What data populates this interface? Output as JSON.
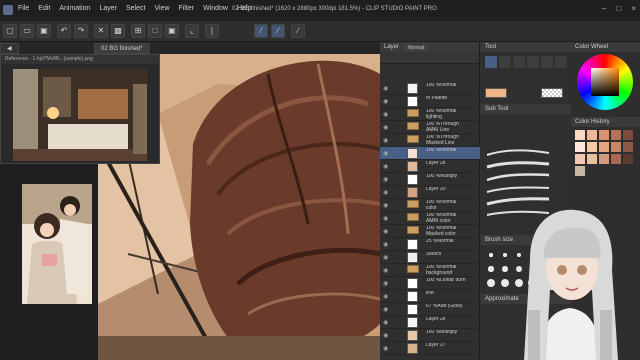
{
  "window": {
    "menu": [
      "File",
      "Edit",
      "Animation",
      "Layer",
      "Select",
      "View",
      "Filter",
      "Window",
      "Help"
    ],
    "title": "02 BG finished* (1620 x 2880px 300dpi 181.5%)  - CLIP STUDIO PAINT PRO"
  },
  "tabs": {
    "canvas_tab": "02 BG finished*"
  },
  "navigator": {
    "header": "Reference - 1-hjd7Mv8N...(sample).png"
  },
  "panels": {
    "layer_header": "Layer",
    "blend_mode": "Normal",
    "tool_header": "Tool",
    "sub_tool_header": "Sub Tool",
    "color_wheel_header": "Color Wheel",
    "color_history_header": "Color History",
    "brush_size_header": "Brush size",
    "approximate_header": "Approximate"
  },
  "layers": [
    {
      "name": "100 %Normal",
      "type": "layer",
      "thumb": "#f2f2f2"
    },
    {
      "name": "In Palette",
      "type": "layer",
      "thumb": "#ffffff"
    },
    {
      "name": "100 %Normal\nlighting",
      "type": "folder"
    },
    {
      "name": "100 %Through\nAMAI Line",
      "type": "folder"
    },
    {
      "name": "100 %Through\nMasked Line",
      "type": "folder"
    },
    {
      "name": "100 %Normal",
      "type": "layer",
      "selected": true,
      "thumb": "#f3e0d6"
    },
    {
      "name": "Layer 28",
      "type": "layer",
      "thumb": "#e0b89a"
    },
    {
      "name": "100 %Multiply",
      "type": "layer",
      "thumb": "#ffffff"
    },
    {
      "name": "Layer 20",
      "type": "layer",
      "thumb": "#d6a382"
    },
    {
      "name": "100 %Normal\ncolor",
      "type": "folder"
    },
    {
      "name": "100 %Normal\nAMAI color",
      "type": "folder"
    },
    {
      "name": "100 %Normal\nMasked color",
      "type": "folder"
    },
    {
      "name": "25 %Normal",
      "type": "layer",
      "thumb": "#ffffff"
    },
    {
      "name": "Sketch",
      "type": "layer",
      "thumb": "#f0f0f0"
    },
    {
      "name": "100 %Normal\nbackground",
      "type": "folder"
    },
    {
      "name": "100 %Linear burn",
      "type": "layer",
      "thumb": "#ffffff"
    },
    {
      "name": "line",
      "type": "layer",
      "thumb": "#ffffff"
    },
    {
      "name": "67 %Add (Glow)",
      "type": "layer",
      "thumb": "#ffffff"
    },
    {
      "name": "Layer 28",
      "type": "layer",
      "thumb": "#f5f5f5"
    },
    {
      "name": "100 %Multiply",
      "type": "layer",
      "thumb": "#e8c8a4"
    },
    {
      "name": "Layer 27",
      "type": "layer",
      "thumb": "#d8b28a"
    }
  ],
  "brush_sizes": [
    1,
    1.5,
    2,
    2.5,
    3,
    4,
    5,
    6,
    7,
    8,
    10,
    12,
    15,
    17,
    20,
    25,
    30,
    40
  ],
  "colors": {
    "accent": "#4a5f86",
    "main_color": "#f0b486",
    "hair": "#6a3b2a"
  },
  "palette_swatches": [
    "#f8d9c2",
    "#efb995",
    "#d9926c",
    "#b3705a",
    "#7b4a3a",
    "#ffe9dd",
    "#f7c7a6",
    "#e5a680",
    "#c88866",
    "#8d5a47",
    "#f4c6b0",
    "#eac1a0",
    "#d29b7b",
    "#a66a55",
    "#5c3a30",
    "#c9b7a6"
  ]
}
